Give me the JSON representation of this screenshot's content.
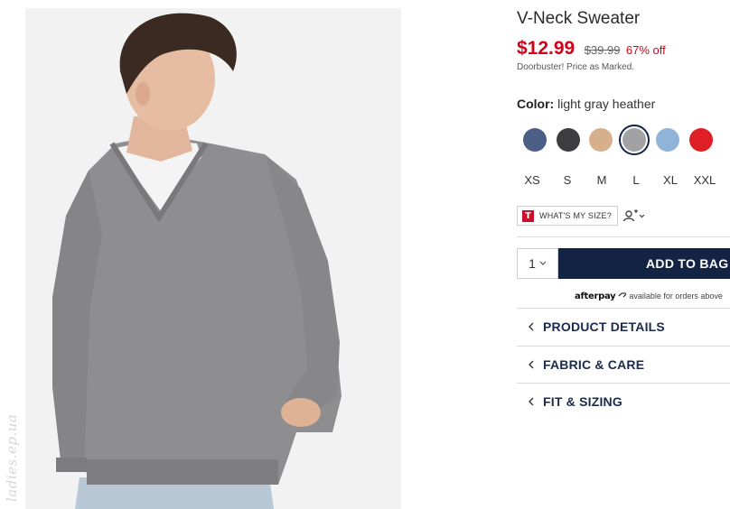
{
  "product": {
    "title": "V-Neck Sweater",
    "sale_price": "$12.99",
    "original_price": "$39.99",
    "discount": "67% off",
    "price_note": "Doorbuster! Price as Marked."
  },
  "color": {
    "label": "Color:",
    "selected": "light gray heather",
    "swatches": [
      {
        "name": "navy heather",
        "hex": "#4a5e86"
      },
      {
        "name": "charcoal",
        "hex": "#3d3d3f"
      },
      {
        "name": "camel",
        "hex": "#d6b08c"
      },
      {
        "name": "light gray heather",
        "hex": "#a2a2a4"
      },
      {
        "name": "light blue",
        "hex": "#8fb3d9"
      },
      {
        "name": "red",
        "hex": "#df1f26"
      }
    ]
  },
  "sizes": [
    "XS",
    "S",
    "M",
    "L",
    "XL",
    "XXL"
  ],
  "fit_tool": {
    "logo_letter": "T",
    "label": "WHAT'S MY SIZE?"
  },
  "purchase": {
    "quantity": "1",
    "add_to_bag": "ADD TO BAG"
  },
  "afterpay": {
    "logo": "afterpay",
    "text": "available for orders above"
  },
  "accordions": [
    {
      "label": "PRODUCT DETAILS"
    },
    {
      "label": "FABRIC & CARE"
    },
    {
      "label": "FIT & SIZING"
    }
  ],
  "watermark": "ladies.ep.ua",
  "colors": {
    "sale_red": "#d0021b",
    "navy": "#122344",
    "sweater_gray": "#8c8c8e"
  }
}
